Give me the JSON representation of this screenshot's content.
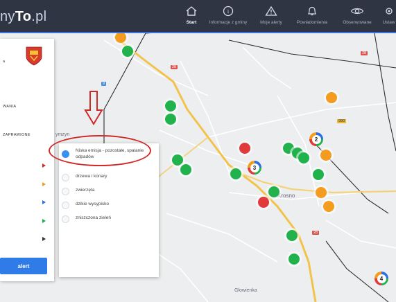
{
  "app": {
    "brand_prefix": "ny",
    "brand_bold": "To",
    "brand_suffix": ".pl"
  },
  "nav": [
    {
      "label": "Start",
      "icon": "home-icon",
      "active": true
    },
    {
      "label": "Informacje z gminy",
      "icon": "info-icon"
    },
    {
      "label": "Moje alerty",
      "icon": "warning-icon"
    },
    {
      "label": "Powiadomienia",
      "icon": "bell-icon"
    },
    {
      "label": "Obserwowane",
      "icon": "eye-icon"
    },
    {
      "label": "Ustaw",
      "icon": "settings-icon"
    }
  ],
  "sidebar": {
    "lines": [
      "a",
      "WANIA",
      "ZAPRAWIONE"
    ],
    "alert_button": "alert"
  },
  "dropdown": {
    "items": [
      {
        "label": "Niska emisja - pozostałe, spalanie odpadów",
        "selected": true
      },
      {
        "label": "drzewa i konary"
      },
      {
        "label": "zwierzęta"
      },
      {
        "label": "dzikie wysypisko"
      },
      {
        "label": "zniszczona zieleń"
      }
    ]
  },
  "map": {
    "places": [
      "ymzyn",
      "Krosno",
      "Głowienka"
    ],
    "roads": [
      "28",
      "9",
      "990",
      "28",
      "28"
    ],
    "clusters": [
      "2",
      "3",
      "4"
    ]
  },
  "colors": {
    "topbar": "#2f3542",
    "accent": "#3d6fe0",
    "green": "#22b24c",
    "red": "#e03a3a",
    "orange": "#f39c1f",
    "annotation": "#cf2a27"
  }
}
